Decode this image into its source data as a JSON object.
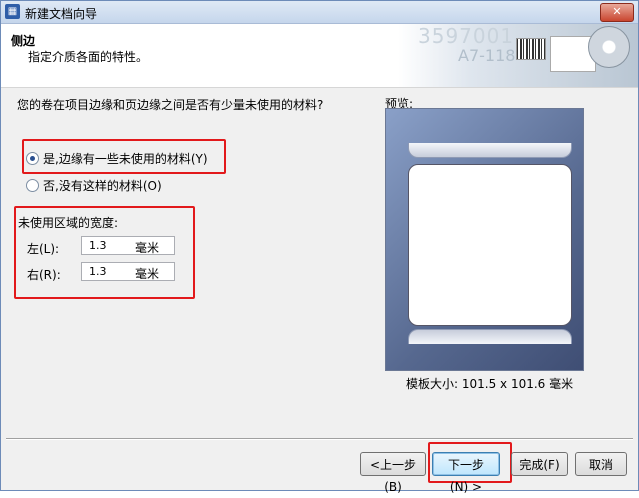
{
  "window": {
    "title": "新建文档向导",
    "app_icon": "bartender-logo-icon",
    "close_label": "✕"
  },
  "header": {
    "title": "侧边",
    "subtitle": "指定介质各面的特性。",
    "art_text_1": "3597001",
    "art_text_2": "A7-118"
  },
  "question": "您的卷在项目边缘和页边缘之间是否有少量未使用的材料?",
  "options": [
    {
      "label": "是,边缘有一些未使用的材料(Y)",
      "selected": true
    },
    {
      "label": "否,没有这样的材料(O)",
      "selected": false
    }
  ],
  "unused_width": {
    "label": "未使用区域的宽度:",
    "left": {
      "label": "左(L):",
      "value": "1.3",
      "unit": "毫米"
    },
    "right": {
      "label": "右(R):",
      "value": "1.3",
      "unit": "毫米"
    }
  },
  "preview": {
    "label": "预览:",
    "size_text": "模板大小: 101.5 x 101.6 毫米"
  },
  "buttons": {
    "back": "<上一步(B)",
    "next": "下一步(N) >",
    "finish": "完成(F)",
    "cancel": "取消"
  },
  "colors": {
    "highlight": "#e2191b",
    "preview_bg": "#56688f"
  }
}
